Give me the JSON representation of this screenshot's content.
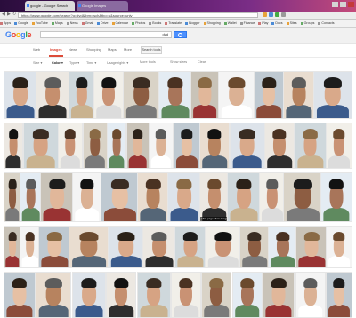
{
  "browser": {
    "tabs": [
      {
        "label": "google - Google Search",
        "active": true
      },
      {
        "label": "Google Images",
        "active": false
      }
    ],
    "url": "https://www.google.com/search?q=dvd&tbm=isch&tbo=u&source=univ",
    "bookmarks": [
      "Apps",
      "Google",
      "YouTube",
      "Maps",
      "News",
      "Gmail",
      "Drive",
      "Calendar",
      "Photos",
      "Books",
      "Translate",
      "Blogger",
      "Shopping",
      "Wallet",
      "Finance",
      "Play",
      "Docs",
      "Sites",
      "Groups",
      "Contacts"
    ]
  },
  "google": {
    "logo": "Google",
    "query": "dvd",
    "nav_tabs": [
      "Web",
      "Images",
      "News",
      "Shopping",
      "Maps",
      "More"
    ],
    "active_tab": "Images",
    "search_tools_label": "Search tools",
    "tools": [
      "Size",
      "Color",
      "Type",
      "Time",
      "Usage rights",
      "More tools",
      "Show sizes",
      "Clear"
    ],
    "selected_tool": "Color"
  },
  "results": {
    "caption": "Visit page View image"
  }
}
